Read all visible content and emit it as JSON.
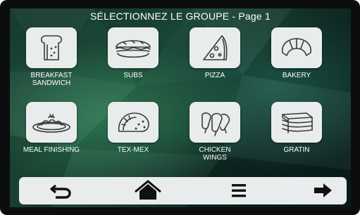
{
  "header": {
    "title": "SÉLECTIONNEZ LE GROUPE - Page 1"
  },
  "groups": [
    {
      "label": "BREAKFAST SANDWICH",
      "label_line1": "BREAKFAST",
      "label_line2": "SANDWICH",
      "icon": "sandwich-bread-icon"
    },
    {
      "label": "SUBS",
      "icon": "sub-sandwich-icon"
    },
    {
      "label": "PIZZA",
      "icon": "pizza-slice-icon"
    },
    {
      "label": "BAKERY",
      "icon": "croissant-icon"
    },
    {
      "label": "MEAL FINISHING",
      "icon": "plated-meal-icon"
    },
    {
      "label": "TEX-MEX",
      "icon": "taco-icon"
    },
    {
      "label": "CHICKEN WINGS",
      "label_line1": "CHICKEN",
      "label_line2": "WINGS",
      "icon": "chicken-wings-icon"
    },
    {
      "label": "GRATIN",
      "icon": "lasagna-gratin-icon"
    }
  ],
  "navbar": {
    "back_icon": "back-arrow-icon",
    "home_icon": "home-icon",
    "menu_icon": "menu-icon",
    "next_icon": "next-arrow-icon"
  },
  "colors": {
    "tile_bg": "#e9ecec",
    "icon_stroke": "#3a3a3a",
    "frame": "#0c0d0e",
    "background_green": "#1d4a39"
  }
}
